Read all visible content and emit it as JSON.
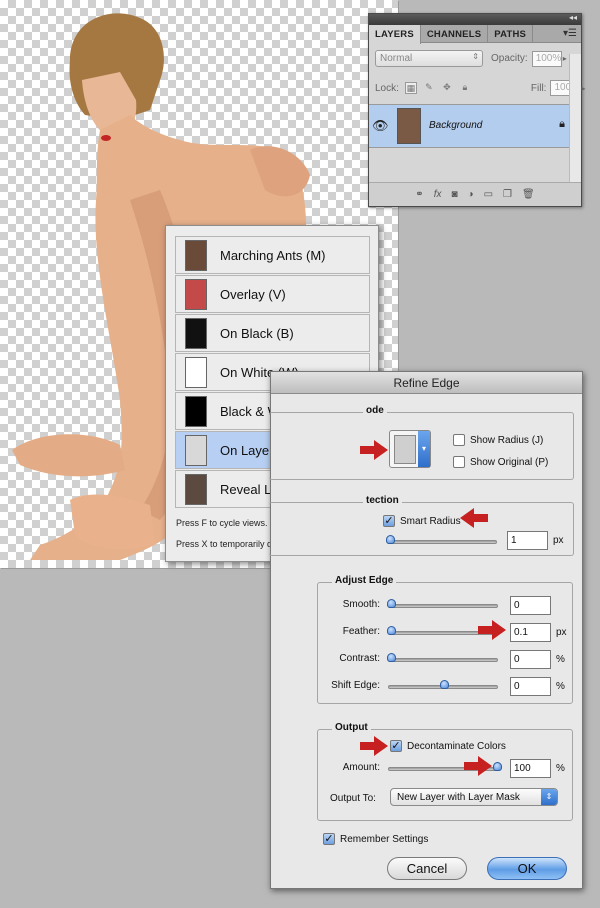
{
  "layers_panel": {
    "tabs": [
      "LAYERS",
      "CHANNELS",
      "PATHS"
    ],
    "blend_mode": "Normal",
    "opacity_label": "Opacity:",
    "opacity_value": "100%",
    "lock_label": "Lock:",
    "fill_label": "Fill:",
    "fill_value": "100%",
    "layer_name": "Background"
  },
  "view_popup": {
    "items": [
      {
        "label": "Marching Ants (M)",
        "thumb": "#6a4a38"
      },
      {
        "label": "Overlay (V)",
        "thumb": "#c44a4a"
      },
      {
        "label": "On Black (B)",
        "thumb": "#111111"
      },
      {
        "label": "On White (W)",
        "thumb": "#ffffff"
      },
      {
        "label": "Black & White (K)",
        "thumb": "#000000"
      },
      {
        "label": "On Layers (L)",
        "thumb": "#d8d8d8"
      },
      {
        "label": "Reveal Layer (R)",
        "thumb": "#5c4a40"
      }
    ],
    "selected_index": 5,
    "hint1": "Press F to cycle views.",
    "hint2": "Press X to temporarily disable all views."
  },
  "refine_edge": {
    "title": "Refine Edge",
    "view_group_label": "ode",
    "show_radius": "Show Radius (J)",
    "show_original": "Show Original (P)",
    "detection_group_label": "tection",
    "smart_radius": "Smart Radius",
    "radius_value": "1",
    "radius_unit": "px",
    "adjust_group_label": "Adjust Edge",
    "smooth_label": "Smooth:",
    "smooth_value": "0",
    "feather_label": "Feather:",
    "feather_value": "0.1",
    "feather_unit": "px",
    "contrast_label": "Contrast:",
    "contrast_value": "0",
    "contrast_unit": "%",
    "shift_label": "Shift Edge:",
    "shift_value": "0",
    "shift_unit": "%",
    "output_group_label": "Output",
    "decontaminate": "Decontaminate Colors",
    "amount_label": "Amount:",
    "amount_value": "100",
    "amount_unit": "%",
    "output_to_label": "Output To:",
    "output_to_value": "New Layer with Layer Mask",
    "remember": "Remember Settings",
    "cancel": "Cancel",
    "ok": "OK"
  }
}
